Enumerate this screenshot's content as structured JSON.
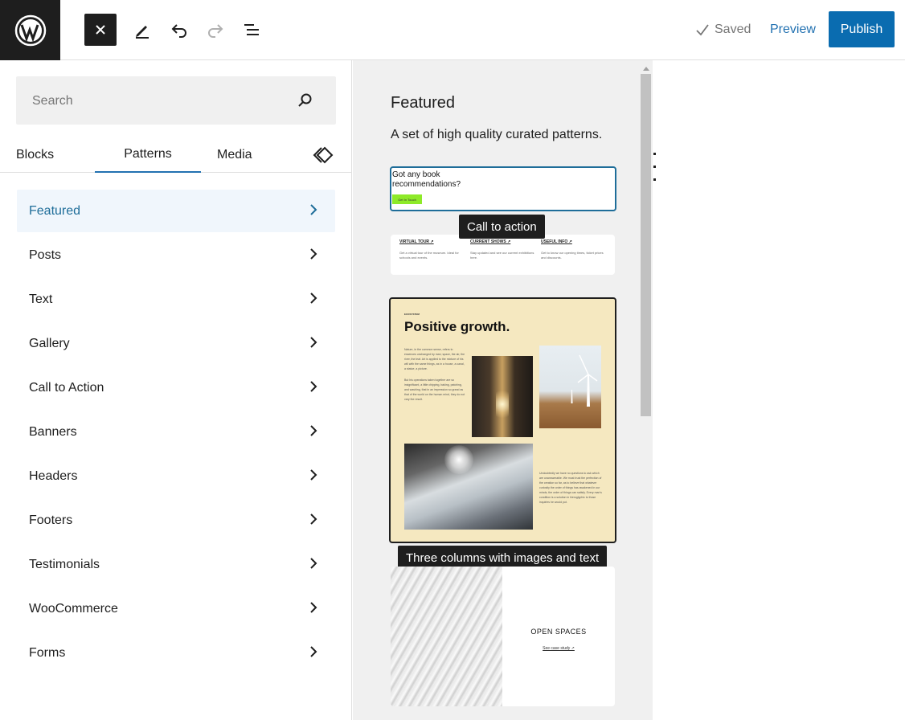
{
  "topbar": {
    "saved_label": "Saved",
    "preview_label": "Preview",
    "publish_label": "Publish"
  },
  "sidebar": {
    "search_placeholder": "Search",
    "tabs": [
      {
        "label": "Blocks"
      },
      {
        "label": "Patterns"
      },
      {
        "label": "Media"
      }
    ],
    "active_tab": "Patterns",
    "categories": [
      {
        "label": "Featured"
      },
      {
        "label": "Posts"
      },
      {
        "label": "Text"
      },
      {
        "label": "Gallery"
      },
      {
        "label": "Call to Action"
      },
      {
        "label": "Banners"
      },
      {
        "label": "Headers"
      },
      {
        "label": "Footers"
      },
      {
        "label": "Testimonials"
      },
      {
        "label": "WooCommerce"
      },
      {
        "label": "Forms"
      }
    ]
  },
  "panel": {
    "title": "Featured",
    "description": "A set of high quality curated patterns.",
    "patterns": {
      "cta": {
        "text": "Got any book recommendations?",
        "button": "Get In Touch",
        "tooltip": "Call to action"
      },
      "three_links": [
        {
          "heading": "VIRTUAL TOUR ↗",
          "text": "Get a virtual tour of the museum. Ideal for schools and events."
        },
        {
          "heading": "CURRENT SHOWS ↗",
          "text": "Stay updated and see our current exhibitions here."
        },
        {
          "heading": "USEFUL INFO ↗",
          "text": "Get to know our opening times, ticket prices and discounts."
        }
      ],
      "three_columns": {
        "eyebrow": "ECOSYSTEM",
        "title": "Positive growth.",
        "para1": "Nature, in the common sense, refers to essences unchanged by man; space, the air, the river, the leaf. Art is applied to the mixture of his will with the same things, as in a house, a canal, a statue, a picture.",
        "para2": "But his operations taken together are so insignificant, a little chipping, baking, patching, and washing, that in an impression so grand as that of the world on the human mind, they do not vary the result.",
        "para3": "Undoubtedly we have no questions to ask which are unanswerable. We must trust the perfection of the creation so far, as to believe that whatever curiosity the order of things has awakened in our minds, the order of things can satisfy. Every man's condition is a solution in hieroglyphic to those inquiries he would put.",
        "tooltip": "Three columns with images and text"
      },
      "open_spaces": {
        "title": "OPEN SPACES",
        "link": "See case study ↗"
      }
    }
  }
}
